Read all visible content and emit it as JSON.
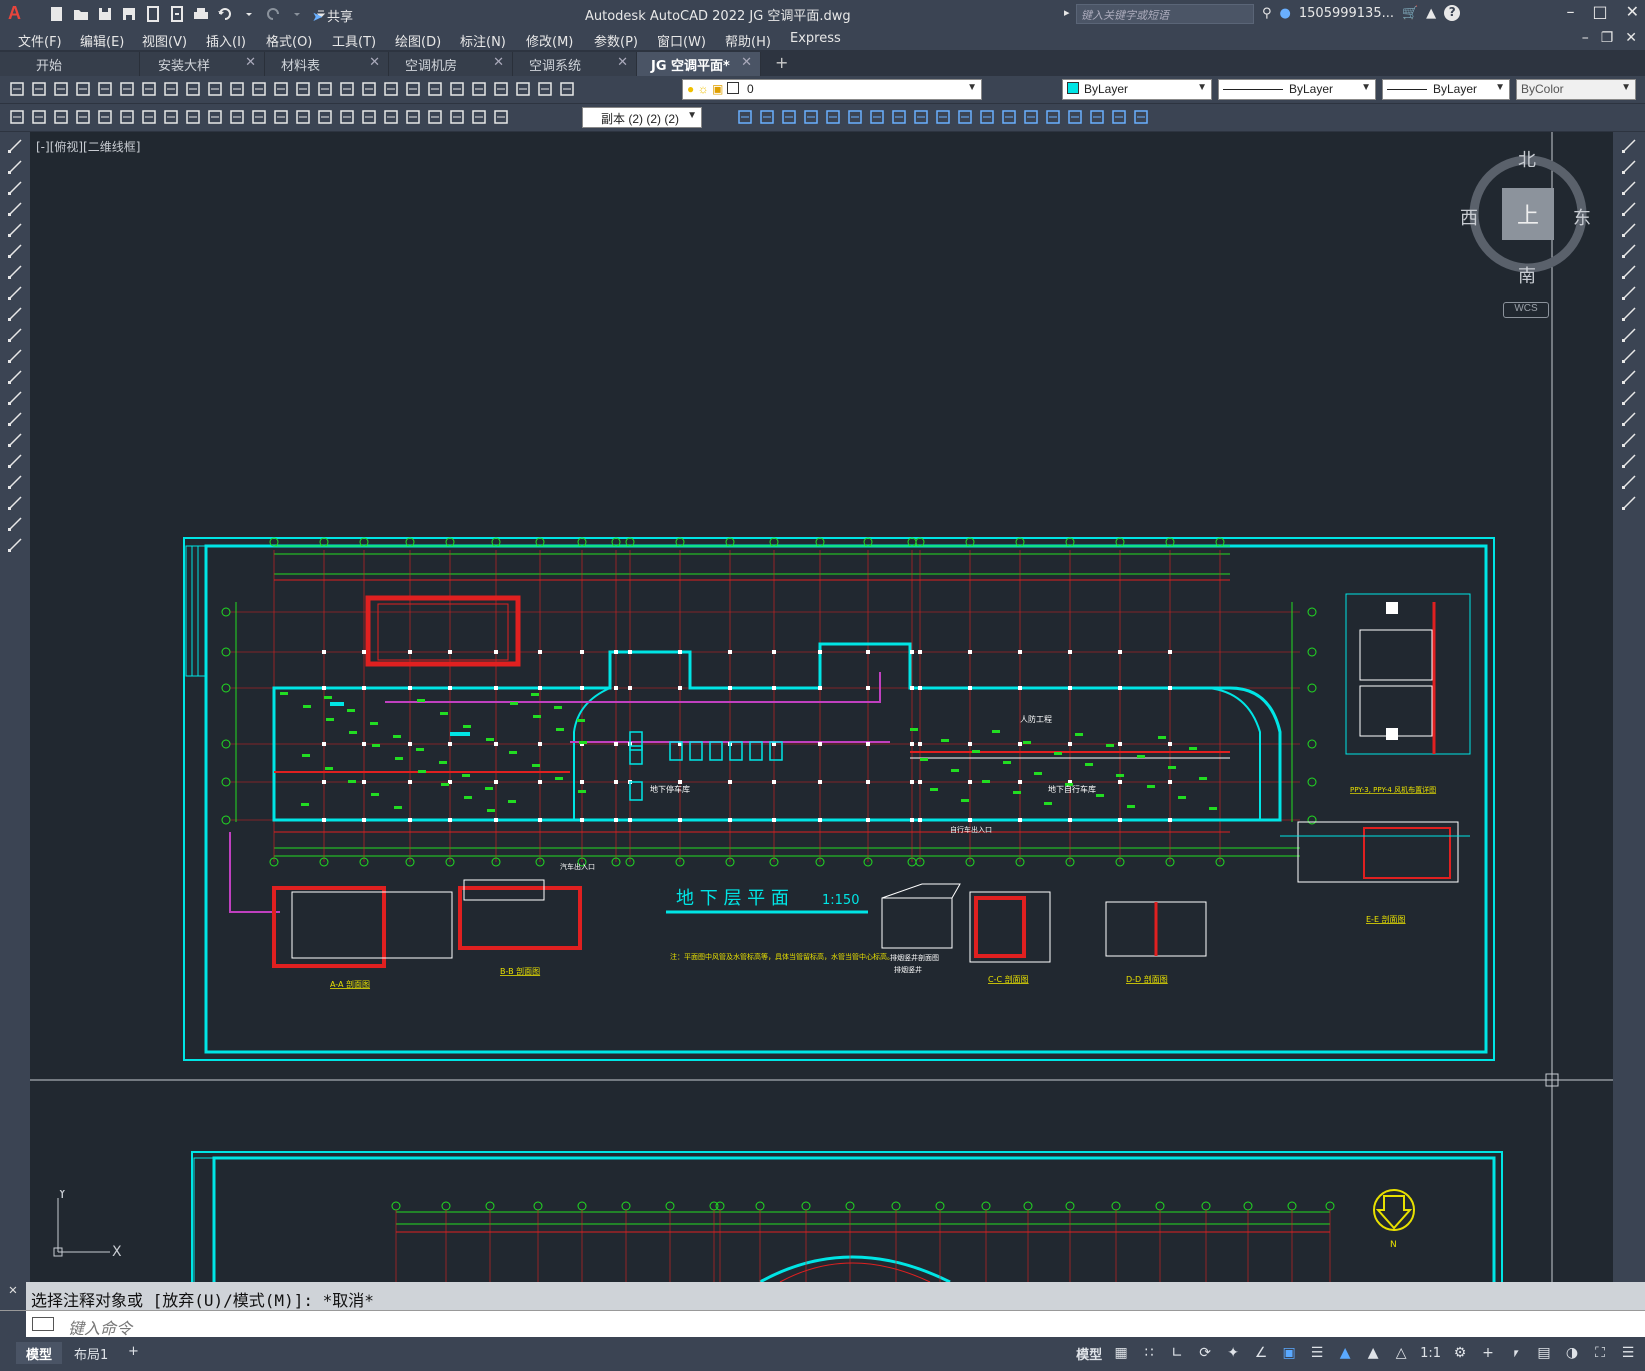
{
  "app": {
    "logo": "A",
    "share_label": "共享",
    "title": "Autodesk AutoCAD 2022   JG 空调平面.dwg",
    "search_placeholder": "键入关键字或短语",
    "user": "1505999135...",
    "help_icon": "?"
  },
  "menu": [
    "文件(F)",
    "编辑(E)",
    "视图(V)",
    "插入(I)",
    "格式(O)",
    "工具(T)",
    "绘图(D)",
    "标注(N)",
    "修改(M)",
    "参数(P)",
    "窗口(W)",
    "帮助(H)",
    "Express"
  ],
  "tabs": [
    {
      "label": "开始"
    },
    {
      "label": "安装大样"
    },
    {
      "label": "材料表"
    },
    {
      "label": "空调机房"
    },
    {
      "label": "空调系统"
    },
    {
      "label": "JG 空调平面*"
    }
  ],
  "toolbar": {
    "layer_value": "0",
    "color_value": "ByLayer",
    "linetype_value": "ByLayer",
    "lineweight_value": "ByLayer",
    "plotstyle_value": "ByColor",
    "dimstyle_value": "副本 (2) (2) (2)"
  },
  "viewport": {
    "label": "[-][俯视][二维线框]"
  },
  "viewcube": {
    "north": "北",
    "south": "南",
    "east": "东",
    "west": "西",
    "top": "上",
    "wcs": "WCS"
  },
  "drawing": {
    "main_title": "地 下 层 平 面",
    "scale": "1:150",
    "section_aa": "A-A 剖面图",
    "section_bb": "B-B 剖面图",
    "section_cc": "C-C 剖面图",
    "section_dd": "D-D 剖面图",
    "section_ee": "E-E 剖面图",
    "fan_detail": "PPY-3, PPY-4 风机布置详图",
    "shaft_label": "排烟竖井",
    "shaft_sub": "排烟竖井剖面图",
    "note": "注：平面图中风管及水管标高等，具体当管留标高，水管当管中心标高。",
    "garage": "地下停车库",
    "bike": "地下自行车库",
    "ramp_car": "汽车出入口",
    "ramp_bike": "自行车出入口",
    "civil": "人防工程",
    "north_arrow": "N"
  },
  "ucs": {
    "x": "X",
    "y": "Y"
  },
  "command": {
    "history": "选择注释对象或 [放弃(U)/模式(M)]: *取消*",
    "placeholder": "键入命令"
  },
  "status": {
    "layouts": [
      "模型",
      "布局1"
    ],
    "model_label": "模型",
    "scale": "1:1"
  },
  "colors": {
    "background": "#212830",
    "chrome": "#3b4453",
    "frame": "#00e5e5",
    "red": "#e02020",
    "green": "#22dd22",
    "yellow": "#e8e000"
  }
}
